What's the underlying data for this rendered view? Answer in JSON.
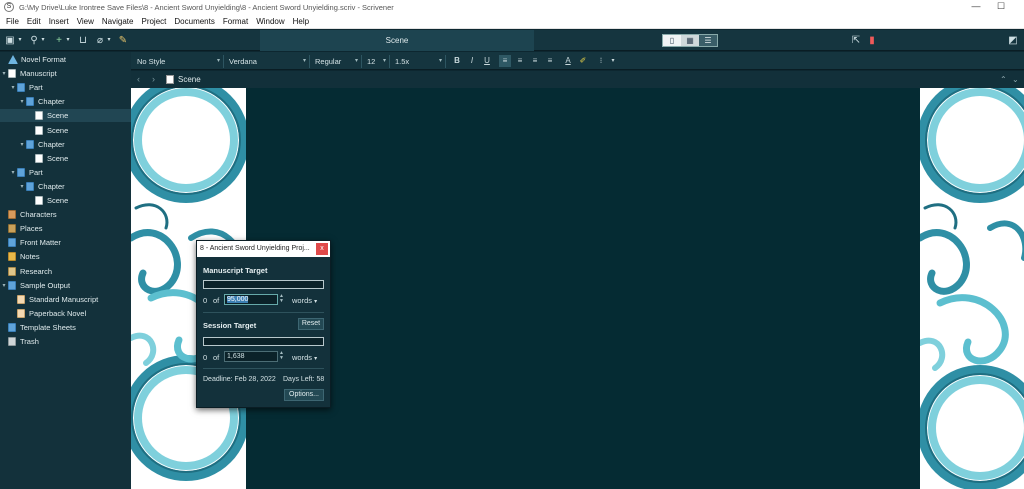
{
  "window": {
    "title": "G:\\My Drive\\Luke Irontree Save Files\\8 - Ancient Sword Unyielding\\8 - Ancient Sword Unyielding.scriv - Scrivener",
    "app_glyph": "S"
  },
  "menu": [
    "File",
    "Edit",
    "Insert",
    "View",
    "Navigate",
    "Project",
    "Documents",
    "Format",
    "Window",
    "Help"
  ],
  "toolbar": {
    "center_title": "Scene"
  },
  "format_bar": {
    "style": "No Style",
    "font": "Verdana",
    "weight": "Regular",
    "size": "12",
    "line_spacing": "1.5x",
    "bold": "B",
    "italic": "I",
    "underline": "U",
    "text_color": "A"
  },
  "header": {
    "doc_title": "Scene"
  },
  "binder": {
    "items": [
      {
        "label": "Novel Format",
        "icon": "triangle",
        "indent": 0,
        "twisty": ""
      },
      {
        "label": "Manuscript",
        "icon": "page",
        "indent": 0,
        "twisty": "▾"
      },
      {
        "label": "Part",
        "icon": "blue",
        "indent": 1,
        "twisty": "▾"
      },
      {
        "label": "Chapter",
        "icon": "blue",
        "indent": 2,
        "twisty": "▾"
      },
      {
        "label": "Scene",
        "icon": "page",
        "indent": 3,
        "twisty": "",
        "selected": true
      },
      {
        "label": "Scene",
        "icon": "page",
        "indent": 3,
        "twisty": ""
      },
      {
        "label": "Chapter",
        "icon": "blue",
        "indent": 2,
        "twisty": "▾"
      },
      {
        "label": "Scene",
        "icon": "page",
        "indent": 3,
        "twisty": ""
      },
      {
        "label": "Part",
        "icon": "blue",
        "indent": 1,
        "twisty": "▾"
      },
      {
        "label": "Chapter",
        "icon": "blue",
        "indent": 2,
        "twisty": "▾"
      },
      {
        "label": "Scene",
        "icon": "page",
        "indent": 3,
        "twisty": ""
      },
      {
        "label": "Characters",
        "icon": "char",
        "indent": 0,
        "twisty": ""
      },
      {
        "label": "Places",
        "icon": "place",
        "indent": 0,
        "twisty": ""
      },
      {
        "label": "Front Matter",
        "icon": "blue",
        "indent": 0,
        "twisty": ""
      },
      {
        "label": "Notes",
        "icon": "folder",
        "indent": 0,
        "twisty": ""
      },
      {
        "label": "Research",
        "icon": "research",
        "indent": 0,
        "twisty": ""
      },
      {
        "label": "Sample Output",
        "icon": "blue",
        "indent": 0,
        "twisty": "▾"
      },
      {
        "label": "Standard Manuscript",
        "icon": "output",
        "indent": 1,
        "twisty": ""
      },
      {
        "label": "Paperback Novel",
        "icon": "output",
        "indent": 1,
        "twisty": ""
      },
      {
        "label": "Template Sheets",
        "icon": "blue",
        "indent": 0,
        "twisty": ""
      },
      {
        "label": "Trash",
        "icon": "trash",
        "indent": 0,
        "twisty": ""
      }
    ]
  },
  "targets_dialog": {
    "title": "8 - Ancient Sword Unyielding Proj...",
    "close": "x",
    "manuscript_heading": "Manuscript Target",
    "manuscript_progress": 0,
    "manuscript_count": "0",
    "of_label": "of",
    "manuscript_target": "95,000",
    "manuscript_unit": "words",
    "session_heading": "Session Target",
    "reset_label": "Reset",
    "session_progress": 0,
    "session_count": "0",
    "session_target": "1,638",
    "session_unit": "words",
    "deadline": "Deadline: Feb 28, 2022",
    "days_left": "Days Left: 58",
    "options_label": "Options..."
  },
  "colors": {
    "accent": "#3c7fb3",
    "editor_bg": "#052b33",
    "wave_dark": "#2f8fa5",
    "wave_light": "#7fd0dc",
    "bookmark": "#f05a5a"
  }
}
